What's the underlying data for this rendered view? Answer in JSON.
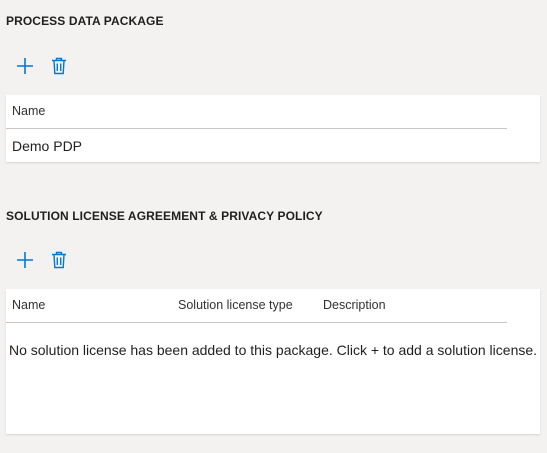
{
  "process_section": {
    "title": "PROCESS DATA PACKAGE",
    "toolbar": {
      "add_icon": "plus-icon",
      "delete_icon": "trash-icon"
    },
    "table": {
      "columns": [
        "Name"
      ],
      "rows": [
        [
          "Demo PDP"
        ]
      ]
    }
  },
  "license_section": {
    "title": "SOLUTION LICENSE AGREEMENT & PRIVACY POLICY",
    "toolbar": {
      "add_icon": "plus-icon",
      "delete_icon": "trash-icon"
    },
    "table": {
      "columns": [
        "Name",
        "Solution license type",
        "Description"
      ],
      "empty_message": "No solution license has been added to this package. Click + to add a solution license."
    }
  },
  "colors": {
    "accent": "#0078d4",
    "background": "#f3f2f1",
    "card": "#ffffff"
  }
}
